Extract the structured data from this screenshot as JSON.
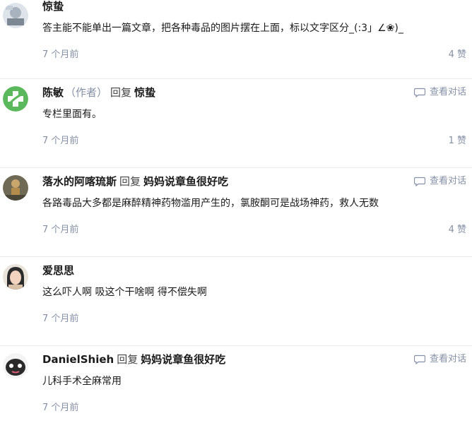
{
  "comments": [
    {
      "name": "惊蛰",
      "author_tag": "",
      "reply_word": "",
      "reply_to": "",
      "content": "答主能不能单出一篇文章，把各种毒品的图片摆在上面，标以文字区分_(:3」∠❀)_",
      "time": "7 个月前",
      "likes": "4 赞",
      "view_conversation": ""
    },
    {
      "name": "陈敏",
      "author_tag": "（作者）",
      "reply_word": "回复",
      "reply_to": "惊蛰",
      "content": "专栏里面有。",
      "time": "7 个月前",
      "likes": "1 赞",
      "view_conversation": "查看对话"
    },
    {
      "name": "落水的阿喀琉斯",
      "author_tag": "",
      "reply_word": "回复",
      "reply_to": "妈妈说章鱼很好吃",
      "content": "各路毒品大多都是麻醉精神药物滥用产生的，氯胺酮可是战场神药，救人无数",
      "time": "7 个月前",
      "likes": "4 赞",
      "view_conversation": "查看对话"
    },
    {
      "name": "爱思思",
      "author_tag": "",
      "reply_word": "",
      "reply_to": "",
      "content": "这么吓人啊 吸这个干啥啊 得不偿失啊",
      "time": "7 个月前",
      "likes": "",
      "view_conversation": ""
    },
    {
      "name": "DanielShieh",
      "author_tag": "",
      "reply_word": "回复",
      "reply_to": "妈妈说章鱼很好吃",
      "content": "儿科手术全麻常用",
      "time": "7 个月前",
      "likes": "",
      "view_conversation": "查看对话"
    }
  ],
  "icons": {
    "conversation": "speech-bubble-icon"
  },
  "colors": {
    "meta_text": "#8590a6",
    "divider": "#ebebeb",
    "avatar_green": "#5cb85c"
  }
}
